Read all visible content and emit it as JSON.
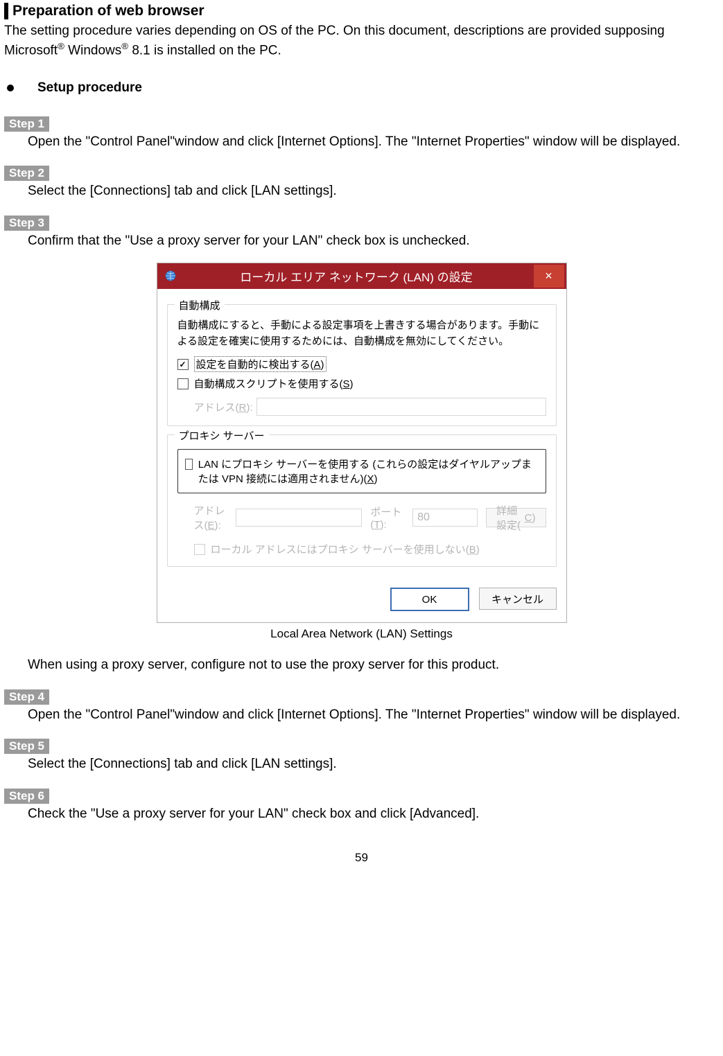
{
  "section_title": "Preparation of web browser",
  "intro_line1": "The setting procedure varies depending on OS of the PC. On this document, descriptions are provided supposing",
  "intro_ms": "Microsoft",
  "intro_sup1": "®",
  "intro_win": " Windows",
  "intro_sup2": "®",
  "intro_line2_rest": " 8.1 is installed on the PC.",
  "setup_heading": "Setup procedure",
  "steps": {
    "s1": {
      "label": "Step 1",
      "body": "Open the \"Control Panel\"window and click [Internet Options]. The \"Internet Properties\" window will be displayed."
    },
    "s2": {
      "label": "Step 2",
      "body": "Select the [Connections] tab and click [LAN settings]."
    },
    "s3": {
      "label": "Step 3",
      "body": "Confirm that the \"Use a proxy server for your LAN\" check box is unchecked."
    },
    "s3_note": "When using a proxy server, configure not to use the proxy server for this product.",
    "s4": {
      "label": "Step 4",
      "body": "Open the \"Control Panel\"window and click [Internet Options]. The \"Internet Properties\" window will be displayed."
    },
    "s5": {
      "label": "Step 5",
      "body": "Select the [Connections] tab and click [LAN settings]."
    },
    "s6": {
      "label": "Step 6",
      "body": "Check the \"Use a proxy server for your LAN\" check box and click [Advanced]."
    }
  },
  "dialog": {
    "title": "ローカル エリア ネットワーク (LAN) の設定",
    "close_glyph": "×",
    "auto_group": {
      "legend": "自動構成",
      "desc": "自動構成にすると、手動による設定事項を上書きする場合があります。手動による設定を確実に使用するためには、自動構成を無効にしてください。",
      "chk_auto_pre": "設定を自動的に検出する(",
      "chk_auto_key": "A",
      "chk_auto_post": ")",
      "chk_script_pre": "自動構成スクリプトを使用する(",
      "chk_script_key": "S",
      "chk_script_post": ")",
      "addr_label_pre": "アドレス(",
      "addr_label_key": "R",
      "addr_label_post": "):"
    },
    "proxy_group": {
      "legend": "プロキシ サーバー",
      "chk_text_pre": "LAN にプロキシ サーバーを使用する (これらの設定はダイヤルアップまたは VPN 接続には適用されません)(",
      "chk_text_key": "X",
      "chk_text_post": ")",
      "addr_label_pre": "アドレス(",
      "addr_label_key": "E",
      "addr_label_post": "):",
      "port_label_pre": "ポート(",
      "port_label_key": "T",
      "port_label_post": "):",
      "port_value": "80",
      "adv_pre": "詳細設定(",
      "adv_key": "C",
      "adv_post": ")",
      "bypass_pre": "ローカル アドレスにはプロキシ サーバーを使用しない(",
      "bypass_key": "B",
      "bypass_post": ")"
    },
    "ok": "OK",
    "cancel": "キャンセル"
  },
  "caption": "Local Area Network (LAN) Settings",
  "page_number": "59"
}
